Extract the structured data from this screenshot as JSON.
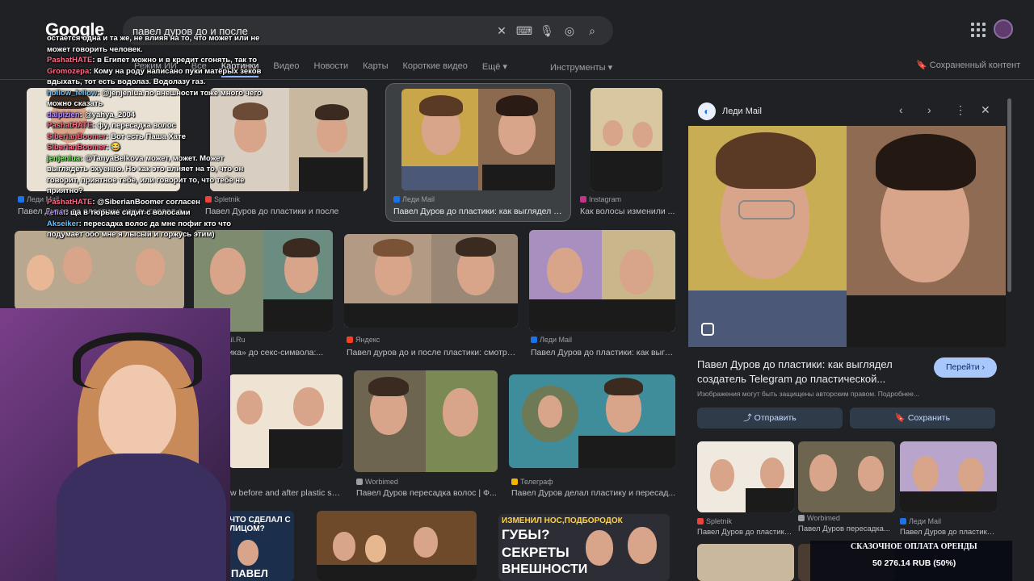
{
  "header": {
    "logo": "Google",
    "query": "павел дуров до и после"
  },
  "tabs": [
    "Режим ИИ",
    "Все",
    "Картинки",
    "Видео",
    "Новости",
    "Карты",
    "Короткие видео",
    "Ещё ▾"
  ],
  "tools_label": "Инструменты ▾",
  "saved_label": "Сохраненный контент",
  "results": [
    {
      "source": "Леди Mail",
      "caption": "Павел Дуров до пластики: как выглядел с..."
    },
    {
      "source": "Spletnik",
      "caption": "Павел Дуров до пластики и после"
    },
    {
      "source": "Леди Mail",
      "caption": "Павел Дуров до пластики: как выглядел с..."
    },
    {
      "source": "Instagram",
      "caption": "Как волосы изменили ..."
    },
    {
      "source": "Mail.Ru",
      "caption": "...аника» до секс-символа:..."
    },
    {
      "source": "Яндекс",
      "caption": "Павел дуров до и после пластики: смотри..."
    },
    {
      "source": "Леди Mail",
      "caption": "Павел Дуров до пластики: как выгл..."
    },
    {
      "source": "",
      "caption": "w before and after plastic su..."
    },
    {
      "source": "Worbimed",
      "caption": "Павел Дуров пересадка волос | Ф..."
    },
    {
      "source": "Телеграф",
      "caption": "Павел Дуров делал пластику и пересад..."
    }
  ],
  "thumb_texts": {
    "t1": "ЧТО СДЕЛАЛ С ЛИЦОМ?",
    "t2": "ПАВЕЛ",
    "t3": "ИЗМЕНИЛ НОС,ПОДБОРОДОК",
    "t4": "ГУБЫ?",
    "t5": "СЕКРЕТЫ",
    "t6": "ВНЕШНОСТИ"
  },
  "chat": [
    {
      "user": "",
      "text": "остается одна и та же, не влияя на то, что может или не может говорить человек."
    },
    {
      "user": "PashatHATE",
      "text": ": в Египет можно и в кредит сгонять, так то"
    },
    {
      "user": "Gromozepa",
      "text": ": Кому на роду написано пуки матёрых зеков вдыхать, тот есть водолаз. Водолазу газ."
    },
    {
      "user": "hollow_fellow",
      "text": ": @jenjenlua по внешности тоже много чего можно сказать"
    },
    {
      "user": "dalpizien",
      "text": ": @yahya_2004"
    },
    {
      "user": "PashatHATE",
      "text": ": фу, пересадка волос"
    },
    {
      "user": "SiberianBoomer",
      "text": ": Вот есть Паша Хате"
    },
    {
      "user": "SiberianBoomer",
      "text": ": 😂"
    },
    {
      "user": "jenjenlua",
      "text": ": @TanyaBelkova может, может. Может выглядеть охуенно. Но как это влияет на то, что он говорит, приятное тебе, или говорит то, что тебе не приятно?"
    },
    {
      "user": "PashatHATE",
      "text": ": @SiberianBoomer согласен"
    },
    {
      "user": "refiat",
      "text": ": ща в тюрьме сидит с волосами"
    },
    {
      "user": "Akseiker",
      "text": ": пересадка волос да мне пофиг кто что подумает обо мне я лысый и горжусь этим)"
    }
  ],
  "panel": {
    "source": "Леди Mail",
    "heading": "Павел Дуров до пластики: как выглядел создатель Telegram до пластической...",
    "goto_label": "Перейти ›",
    "copyright": "Изображения могут быть защищены авторским правом. Подробнее...",
    "share_label": "Отправить",
    "save_label": "Сохранить",
    "related": [
      {
        "source": "Spletnik",
        "caption": "Павел Дуров до пластики ..."
      },
      {
        "source": "Worbimed",
        "caption": "Павел Дуров пересадка..."
      },
      {
        "source": "Леди Mail",
        "caption": "Павел Дуров до пластики:..."
      }
    ]
  },
  "ticker": {
    "line1": "СКАЗОЧНОЕ ОПЛАТА ОРЕНДЫ",
    "line2": "50 276.14 RUB (50%)"
  },
  "colors": {
    "accent": "#8ab4f8",
    "button_blue": "#a8c7fa",
    "bg": "#202124"
  }
}
